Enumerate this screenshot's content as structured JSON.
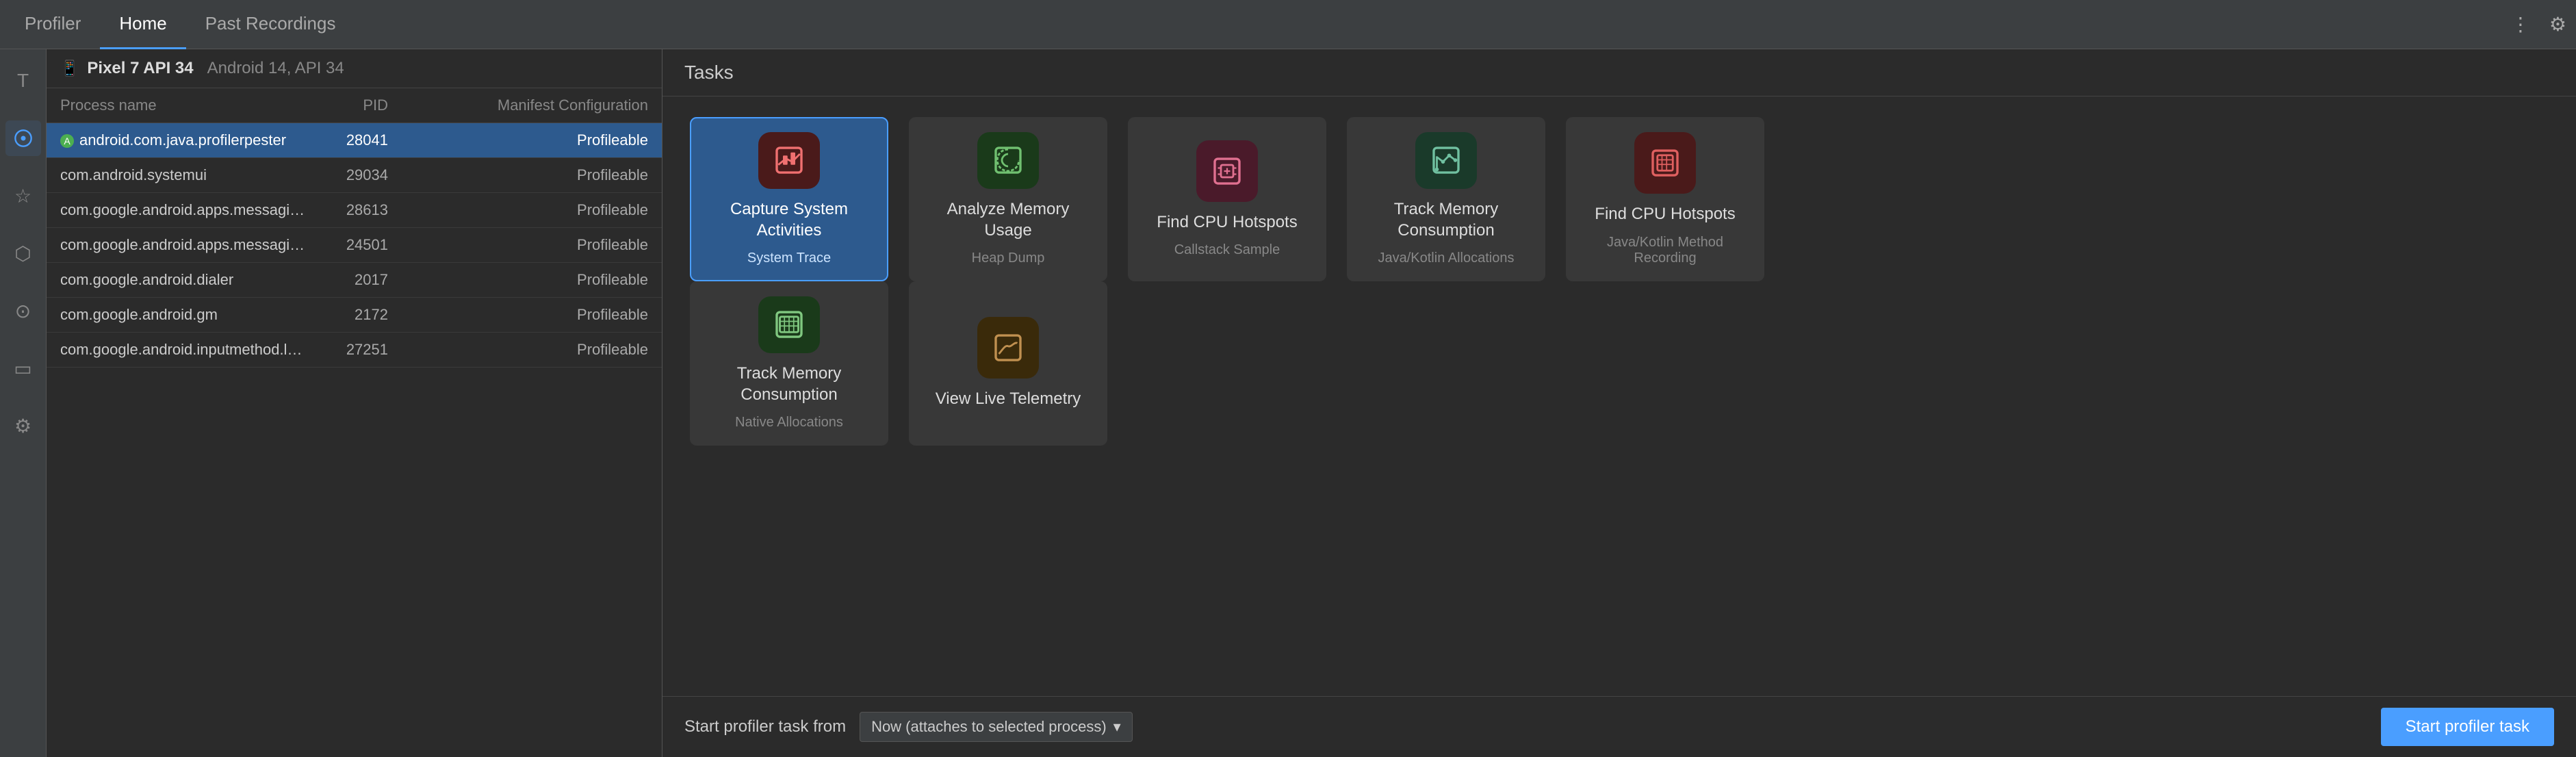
{
  "tabs": [
    {
      "id": "profiler",
      "label": "Profiler",
      "active": false
    },
    {
      "id": "home",
      "label": "Home",
      "active": true
    },
    {
      "id": "past-recordings",
      "label": "Past Recordings",
      "active": false
    }
  ],
  "header": {
    "more_icon": "⋮",
    "settings_icon": "⚙"
  },
  "sidebar_icons": [
    {
      "id": "terminal",
      "symbol": "T",
      "active": false
    },
    {
      "id": "profiler-icon",
      "symbol": "◎",
      "active": true
    },
    {
      "id": "bookmark",
      "symbol": "☆",
      "active": false
    },
    {
      "id": "build",
      "symbol": "✦",
      "active": false
    },
    {
      "id": "time",
      "symbol": "⊙",
      "active": false
    },
    {
      "id": "screen",
      "symbol": "▭",
      "active": false
    },
    {
      "id": "settings2",
      "symbol": "⚙",
      "active": false
    }
  ],
  "device": {
    "icon": "📱",
    "name": "Pixel 7 API 34",
    "api": "Android 14, API 34"
  },
  "process_table": {
    "headers": [
      "Process name",
      "PID",
      "Manifest Configuration"
    ],
    "rows": [
      {
        "name": "android.com.java.profilerpester",
        "pid": "28041",
        "manifest": "Profileable",
        "selected": true,
        "has_icon": true
      },
      {
        "name": "com.android.systemui",
        "pid": "29034",
        "manifest": "Profileable",
        "selected": false,
        "has_icon": false
      },
      {
        "name": "com.google.android.apps.messaging",
        "pid": "28613",
        "manifest": "Profileable",
        "selected": false,
        "has_icon": false
      },
      {
        "name": "com.google.android.apps.messaging...",
        "pid": "24501",
        "manifest": "Profileable",
        "selected": false,
        "has_icon": false
      },
      {
        "name": "com.google.android.dialer",
        "pid": "2017",
        "manifest": "Profileable",
        "selected": false,
        "has_icon": false
      },
      {
        "name": "com.google.android.gm",
        "pid": "2172",
        "manifest": "Profileable",
        "selected": false,
        "has_icon": false
      },
      {
        "name": "com.google.android.inputmethod.latin",
        "pid": "27251",
        "manifest": "Profileable",
        "selected": false,
        "has_icon": false
      }
    ]
  },
  "tasks": {
    "header": "Tasks",
    "rows": [
      [
        {
          "id": "capture-system",
          "title": "Capture System Activities",
          "subtitle": "System Trace",
          "icon_color": "red",
          "selected": true
        },
        {
          "id": "analyze-memory",
          "title": "Analyze Memory Usage",
          "subtitle": "Heap Dump",
          "icon_color": "green",
          "selected": false
        },
        {
          "id": "find-cpu",
          "title": "Find CPU Hotspots",
          "subtitle": "Callstack Sample",
          "icon_color": "pink",
          "selected": false
        },
        {
          "id": "track-memory",
          "title": "Track Memory Consumption",
          "subtitle": "Java/Kotlin Allocations",
          "icon_color": "teal",
          "selected": false
        },
        {
          "id": "find-cpu-2",
          "title": "Find CPU Hotspots",
          "subtitle": "Java/Kotlin Method Recording",
          "icon_color": "red2",
          "selected": false
        }
      ],
      [
        {
          "id": "track-memory-2",
          "title": "Track Memory Consumption",
          "subtitle": "Native Allocations",
          "icon_color": "green2",
          "selected": false
        },
        {
          "id": "view-live",
          "title": "View Live Telemetry",
          "subtitle": "",
          "icon_color": "orange",
          "selected": false
        }
      ]
    ]
  },
  "bottom_bar": {
    "label": "Start profiler task from",
    "dropdown_value": "Now (attaches to selected process)",
    "dropdown_arrow": "▾",
    "start_button": "Start profiler task"
  }
}
